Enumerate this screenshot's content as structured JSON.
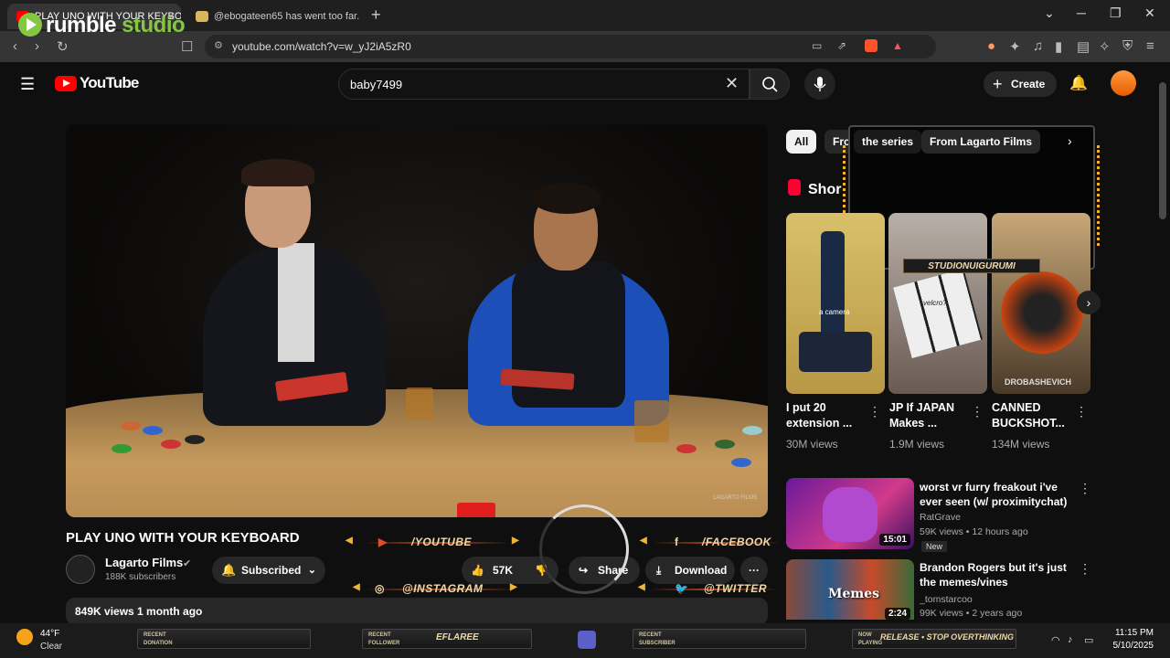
{
  "browser": {
    "tabs": [
      {
        "title": "PLAY UNO WITH YOUR KEYBOARD",
        "active": true
      },
      {
        "title": "@ebogateen65 has went too far...",
        "active": false
      }
    ],
    "url": "youtube.com/watch?v=w_yJ2iA5zR0"
  },
  "overlay_brand": {
    "word1": "rumble",
    "word2": " studio"
  },
  "youtube": {
    "logo_text": "YouTube",
    "search_value": "baby7499",
    "create_label": "Create"
  },
  "video": {
    "watermark": "LAGARTO FILMS",
    "title": "PLAY UNO WITH YOUR KEYBOARD",
    "channel": "Lagarto Films",
    "subscribers": "188K subscribers",
    "subscribe_label": "Subscribed",
    "likes": "57K",
    "share_label": "Share",
    "download_label": "Download",
    "meta": "849K views  1 month ago"
  },
  "socials": {
    "youtube": "/YOUTUBE",
    "facebook": "/FACEBOOK",
    "instagram": "@INSTAGRAM",
    "twitter": "@TWITTER",
    "studio_tag": "STUDIONUIGURUMI"
  },
  "chips": [
    {
      "label": "All"
    },
    {
      "label": "Fro"
    },
    {
      "label": "the series"
    },
    {
      "label": "From Lagarto Films"
    }
  ],
  "shorts": {
    "heading": "Shor",
    "items": [
      {
        "title": "I put 20 extension ...",
        "views": "30M views",
        "overlay": "a camera"
      },
      {
        "title": "JP If JAPAN Makes ...",
        "views": "1.9M views",
        "overlay": "velcro?"
      },
      {
        "title": "CANNED BUCKSHOT...",
        "views": "134M views",
        "overlay": "DROBASHEVICH"
      }
    ]
  },
  "recommended": [
    {
      "title": "worst vr furry freakout i've ever seen (w/ proximitychat)",
      "channel": "RatGrave",
      "meta": "59K views • 12 hours ago",
      "duration": "15:01",
      "badge": "New"
    },
    {
      "title": "Brandon Rogers but it's just the memes/vines",
      "channel": "_tomstarcoo",
      "meta": "99K views • 2 years ago",
      "duration": "2:24",
      "overlay": "Memes"
    }
  ],
  "taskbar": {
    "temp": "44°F",
    "condition": "Clear",
    "panels": [
      {
        "label1": "RECENT",
        "label2": "DONATION"
      },
      {
        "label1": "RECENT",
        "label2": "FOLLOWER",
        "value": "EFLAREE"
      },
      {
        "label1": "RECENT",
        "label2": "SUBSCRIBER"
      },
      {
        "label1": "NOW",
        "label2": "PLAYING",
        "value": "RELEASE • STOP OVERTHINKING"
      }
    ],
    "time": "11:15 PM",
    "date": "5/10/2025"
  },
  "colors": {
    "accent_red": "#ff0000",
    "rumble_green": "#85c742",
    "overlay_gold": "#f2b233"
  }
}
